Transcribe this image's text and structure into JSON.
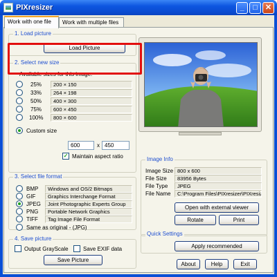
{
  "window": {
    "title": "PIXresizer",
    "minimize": "_",
    "maximize": "□",
    "close": "✕"
  },
  "tabs": [
    {
      "label": "Work with one file"
    },
    {
      "label": "Work with multiple files"
    }
  ],
  "load_picture": {
    "title": "1. Load picture",
    "button": "Load Picture"
  },
  "select_size": {
    "title": "2. Select new size",
    "available_label": "Available sizes for this image:",
    "options": [
      {
        "percent": "25%",
        "size": "200  ×  150"
      },
      {
        "percent": "33%",
        "size": "264  ×  198"
      },
      {
        "percent": "50%",
        "size": "400  ×  300"
      },
      {
        "percent": "75%",
        "size": "600  ×  450"
      },
      {
        "percent": "100%",
        "size": "800  ×  600"
      }
    ],
    "custom_label": "Custom size",
    "custom_width": "600",
    "by": "x",
    "custom_height": "450",
    "maintain_label": "Maintain aspect ratio"
  },
  "file_format": {
    "title": "3. Select file format",
    "options": [
      {
        "code": "BMP",
        "desc": "Windows and OS/2 Bitmaps"
      },
      {
        "code": "GIF",
        "desc": "Graphics Interchange Format"
      },
      {
        "code": "JPEG",
        "desc": "Joint Photographic Experts Group"
      },
      {
        "code": "PNG",
        "desc": "Portable Network Graphics"
      },
      {
        "code": "TIFF",
        "desc": "Tag Image File Format"
      }
    ],
    "same_label": "Same as original  - (JPG)"
  },
  "save_picture": {
    "title": "4. Save picture",
    "grayscale_label": "Output GrayScale",
    "exif_label": "Save EXIF data",
    "button": "Save Picture"
  },
  "image_info": {
    "title": "Image Info",
    "rows": [
      {
        "label": "Image Size",
        "value": "800 x 600"
      },
      {
        "label": "File Size",
        "value": "83956 Bytes"
      },
      {
        "label": "File Type",
        "value": "JPEG"
      },
      {
        "label": "File Name",
        "value": "C:\\Program Files\\PIXresizer\\PIXresiz"
      }
    ],
    "open_external": "Open with external viewer",
    "rotate": "Rotate",
    "print": "Print"
  },
  "quick_settings": {
    "title": "Quick Settings",
    "apply": "Apply recommended"
  },
  "footer": {
    "about": "About",
    "help": "Help",
    "exit": "Exit"
  },
  "colors": {
    "highlight": "#e20d0d",
    "group_title": "#1f4fd0",
    "titlebar": "#0a4bd0"
  }
}
